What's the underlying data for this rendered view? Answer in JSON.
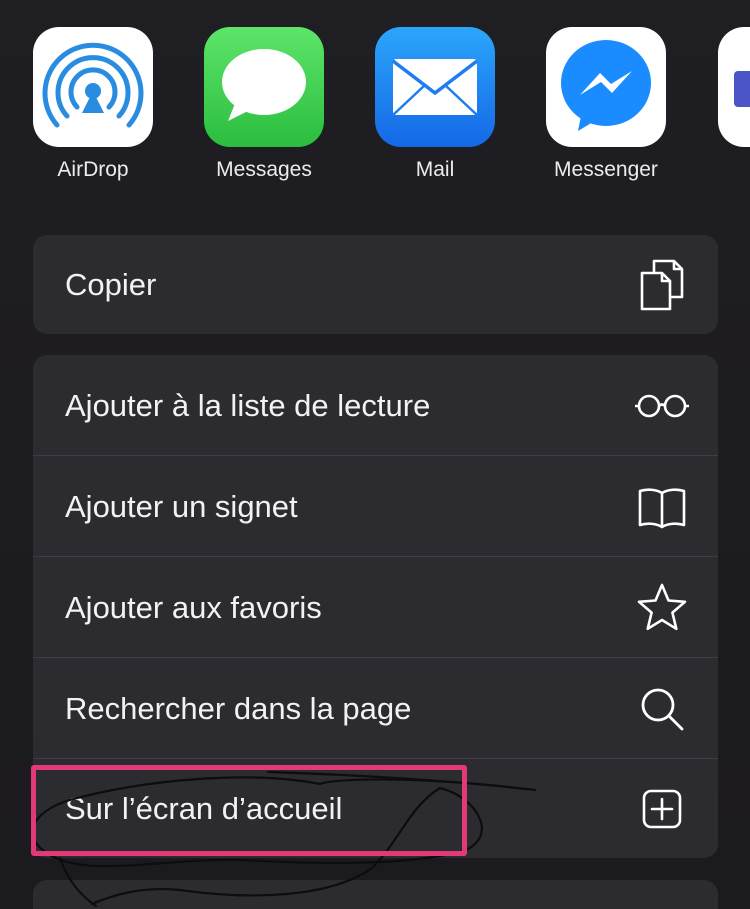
{
  "share_apps": [
    {
      "label": "AirDrop",
      "icon": "airdrop-icon"
    },
    {
      "label": "Messages",
      "icon": "messages-icon"
    },
    {
      "label": "Mail",
      "icon": "mail-icon"
    },
    {
      "label": "Messenger",
      "icon": "messenger-icon"
    },
    {
      "label": "",
      "icon": "partial-app-icon"
    }
  ],
  "actions_group_1": [
    {
      "label": "Copier",
      "icon": "copy-icon"
    }
  ],
  "actions_group_2": [
    {
      "label": "Ajouter à la liste de lecture",
      "icon": "glasses-icon"
    },
    {
      "label": "Ajouter un signet",
      "icon": "book-icon"
    },
    {
      "label": "Ajouter aux favoris",
      "icon": "star-icon"
    },
    {
      "label": "Rechercher dans la page",
      "icon": "search-icon"
    },
    {
      "label": "Sur l’écran d’accueil",
      "icon": "add-square-icon"
    }
  ],
  "colors": {
    "background": "#1c1c1e",
    "group_background": "#2c2b30",
    "highlight": "#e23a78",
    "messages_green": "#33c748",
    "mail_blue": "#1e7df0",
    "messenger_blue": "#1a8cff",
    "airdrop_blue": "#2a8ce0"
  }
}
